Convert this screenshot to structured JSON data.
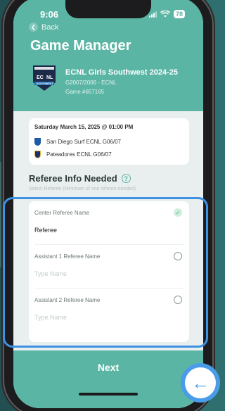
{
  "status_bar": {
    "time": "9:06",
    "battery": "78"
  },
  "nav": {
    "back_label": "Back"
  },
  "page": {
    "title": "Game Manager"
  },
  "game": {
    "league_name": "ECNL Girls Southwest 2024-25",
    "division": "G2007/2006 - ECNL",
    "game_number": "Game #657165",
    "logo_text_top": "EC",
    "logo_text_right": "NL",
    "logo_banner": "SOUTHWEST"
  },
  "match": {
    "datetime": "Saturday March 15, 2025 @ 01:00 PM",
    "home_team": "San Diego Surf ECNL G06/07",
    "away_team": "Pateadores ECNL G06/07"
  },
  "referee": {
    "heading": "Referee Info Needed",
    "help_icon": "?",
    "subtitle": "Select Referee (Minimum of one referee needed)",
    "fields": [
      {
        "label": "Center Referee Name",
        "value": "Referee",
        "placeholder": "",
        "status": "checked"
      },
      {
        "label": "Assistant 1 Referee Name",
        "value": "",
        "placeholder": "Type Name",
        "status": "empty"
      },
      {
        "label": "Assistant 2 Referee Name",
        "value": "",
        "placeholder": "Type Name",
        "status": "empty"
      }
    ]
  },
  "footer": {
    "next_label": "Next"
  },
  "colors": {
    "primary": "#5ab5a4",
    "highlight": "#3d92e3",
    "fab": "#4a9ce8"
  }
}
